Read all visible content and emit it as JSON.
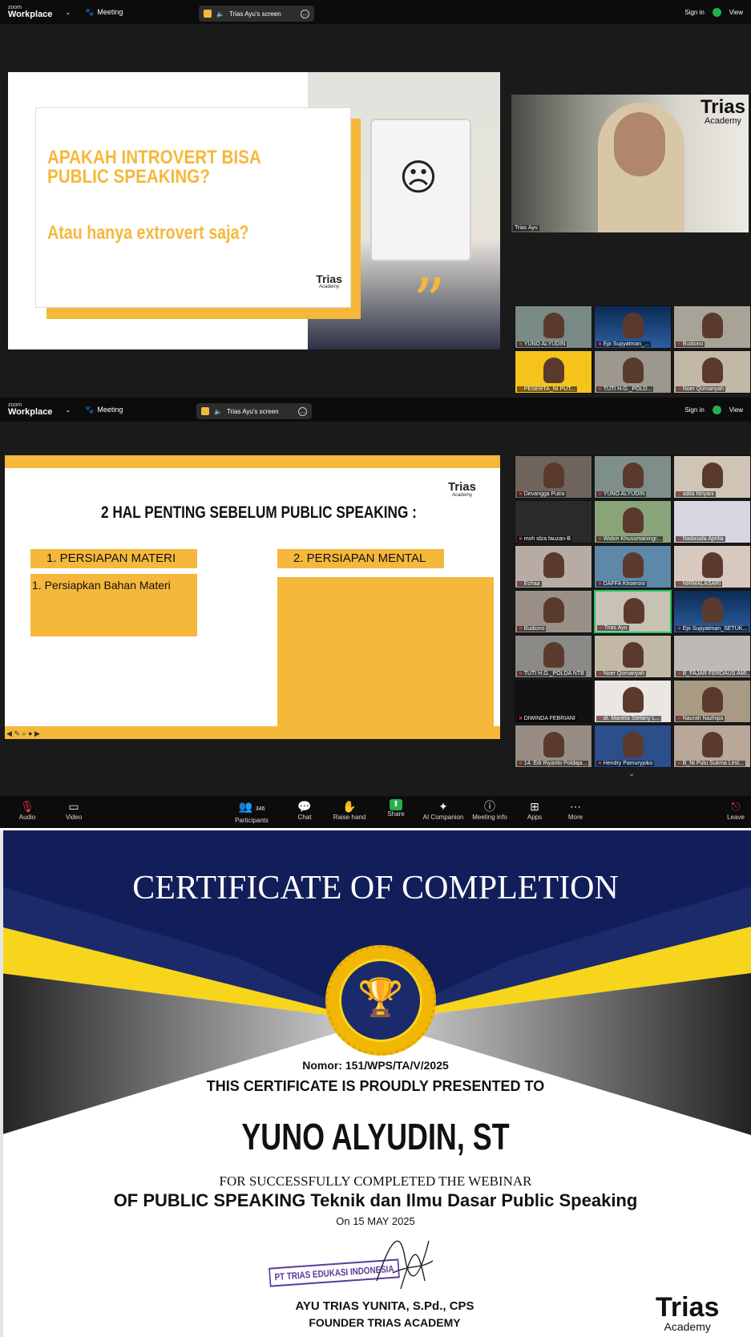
{
  "zoom": {
    "brand_top": "zoom",
    "brand_name": "Workplace",
    "meeting_label": "Meeting",
    "share_label": "Trias Ayu's screen",
    "sign_in": "Sign in",
    "view": "View"
  },
  "slide1": {
    "heading_line1": "APAKAH INTROVERT BISA",
    "heading_line2": "PUBLIC SPEAKING?",
    "subheading": "Atau hanya extrovert saja?",
    "logo_main": "Trias",
    "logo_sub": "Academy"
  },
  "speaker": {
    "name": "Trias Ayu",
    "logo_main": "Trias",
    "logo_sub": "Academy"
  },
  "gallery1": [
    "YUNO ALYUDIN",
    "Epi Supyatman_...",
    "Budiono",
    "PESERTA_NI PUT...",
    "TUTI H.G._POLD...",
    "Noer Qomariyah"
  ],
  "slide2": {
    "title": "2 HAL PENTING SEBELUM PUBLIC SPEAKING :",
    "col1_header": "1.  PERSIAPAN MATERI",
    "col1_item": "1.   Persiapkan Bahan Materi",
    "col2_header": "2.  PERSIAPAN MENTAL",
    "logo_main": "Trias",
    "logo_sub": "Academy"
  },
  "gallery2": [
    "Devangga Putra",
    "YUNO ALYUDIN",
    "adila fitriyani",
    "moh idza fauzan-B",
    "Widori Khusumaningr...",
    "Nadasafa Aprilia",
    "Echaa",
    "DAFFA Khoeroni",
    "NIRMALASARI",
    "Budiono",
    "Trias Ayu",
    "Epi Supyatman_SETUK...",
    "TUTI H.G._POLDA NTB",
    "Noer Qomariyah",
    "B_FAJAR FERDAUS AMI...",
    "DIWINDA FEBRIANI",
    "dr. Marieta Stefany L...",
    "Naurah Nazhipa",
    "14. Edi Riyanto Poldaja...",
    "Hendry Pamuryjoko",
    "B_Ni Putu Sukma Lest..."
  ],
  "toolbar": {
    "audio": "Audio",
    "video": "Video",
    "participants": "Participants",
    "participants_count": "346",
    "chat": "Chat",
    "raise_hand": "Raise hand",
    "share": "Share",
    "ai_companion": "AI Companion",
    "meeting_info": "Meeting info",
    "apps": "Apps",
    "more": "More",
    "leave": "Leave"
  },
  "certificate": {
    "title": "CERTIFICATE OF COMPLETION",
    "number": "Nomor: 151/WPS/TA/V/2025",
    "presented": "THIS CERTIFICATE IS PROUDLY PRESENTED TO",
    "recipient": "YUNO ALYUDIN, ST",
    "line1": "FOR SUCCESSFULLY COMPLETED THE WEBINAR",
    "line2": "OF PUBLIC SPEAKING Teknik dan Ilmu Dasar Public Speaking",
    "date": "On 15 MAY 2025",
    "stamp": "PT TRIAS EDUKASI INDONESIA",
    "signer": "AYU TRIAS YUNITA, S.Pd., CPS",
    "signer_role": "FOUNDER TRIAS ACADEMY",
    "logo_main": "Trias",
    "logo_sub": "Academy"
  },
  "colors": {
    "accent_yellow": "#f5b83b",
    "navy": "#1b2a6b",
    "gold": "#f2b705"
  }
}
